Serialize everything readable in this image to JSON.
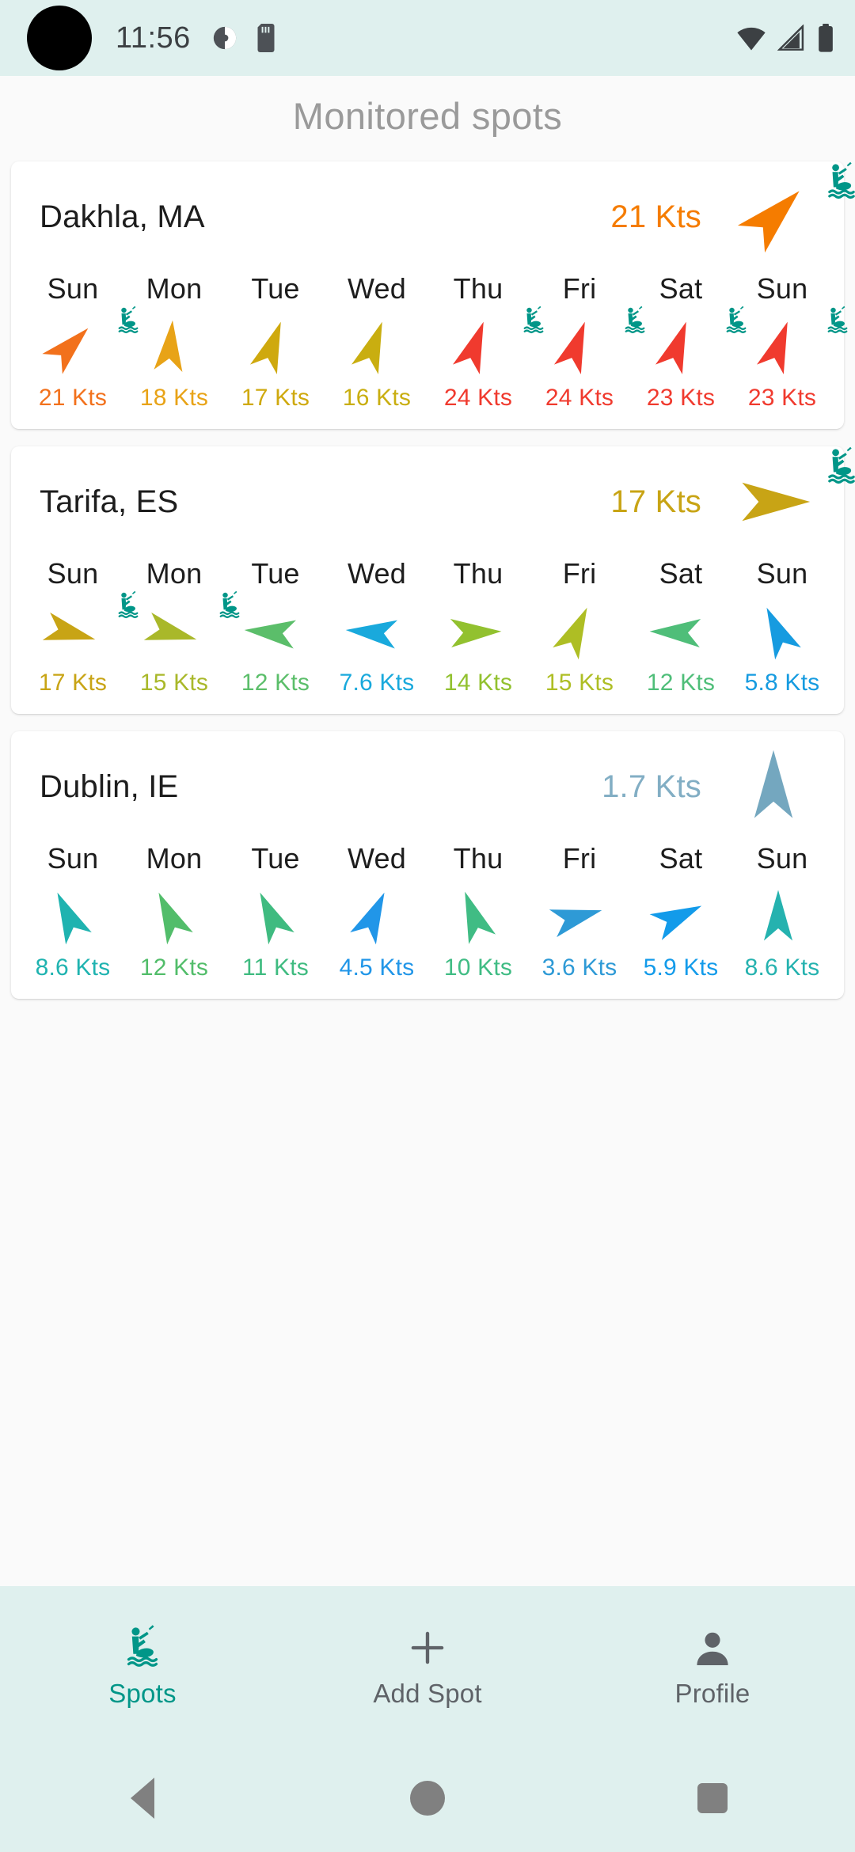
{
  "statusbar": {
    "time": "11:56",
    "icons_left": [
      "do-not-disturb-icon",
      "sd-card-icon"
    ],
    "icons_right": [
      "wifi-icon",
      "cellular-signal-icon",
      "battery-icon"
    ]
  },
  "header": {
    "title": "Monitored spots"
  },
  "theme": {
    "accent": "#009688",
    "statusbar_bg": "#DFF0EE",
    "page_bg": "#FAFAFA",
    "card_bg": "#FFFFFF"
  },
  "cards": [
    {
      "name": "Dakhla, MA",
      "speed": "21 Kts",
      "speed_color": "#F57C00",
      "arrow_color": "#F57C00",
      "arrow_dir": 225,
      "kitable": true,
      "days": [
        {
          "label": "Sun",
          "speed": "21 Kts",
          "color": "#F2711C",
          "dir": 225,
          "kitable": true
        },
        {
          "label": "Mon",
          "speed": "18 Kts",
          "color": "#E8A317",
          "dir": 185,
          "kitable": false
        },
        {
          "label": "Tue",
          "speed": "17 Kts",
          "color": "#CFA90E",
          "dir": 200,
          "kitable": false
        },
        {
          "label": "Wed",
          "speed": "16 Kts",
          "color": "#C9AE10",
          "dir": 200,
          "kitable": false
        },
        {
          "label": "Thu",
          "speed": "24 Kts",
          "color": "#F03A2E",
          "dir": 200,
          "kitable": true
        },
        {
          "label": "Fri",
          "speed": "24 Kts",
          "color": "#F03A2E",
          "dir": 200,
          "kitable": true
        },
        {
          "label": "Sat",
          "speed": "23 Kts",
          "color": "#F03A2E",
          "dir": 200,
          "kitable": true
        },
        {
          "label": "Sun",
          "speed": "23 Kts",
          "color": "#F03A2E",
          "dir": 200,
          "kitable": true
        }
      ]
    },
    {
      "name": "Tarifa, ES",
      "speed": "17 Kts",
      "speed_color": "#C8A415",
      "arrow_color": "#C8A415",
      "arrow_dir": 270,
      "kitable": true,
      "days": [
        {
          "label": "Sun",
          "speed": "17 Kts",
          "color": "#C8A415",
          "dir": 285,
          "kitable": true
        },
        {
          "label": "Mon",
          "speed": "15 Kts",
          "color": "#A9B82A",
          "dir": 285,
          "kitable": true
        },
        {
          "label": "Tue",
          "speed": "12 Kts",
          "color": "#5BBE6A",
          "dir": 95,
          "kitable": false
        },
        {
          "label": "Wed",
          "speed": "7.6 Kts",
          "color": "#19A9DC",
          "dir": 95,
          "kitable": false
        },
        {
          "label": "Thu",
          "speed": "14 Kts",
          "color": "#92C12F",
          "dir": 268,
          "kitable": false
        },
        {
          "label": "Fri",
          "speed": "15 Kts",
          "color": "#AEBE24",
          "dir": 205,
          "kitable": false
        },
        {
          "label": "Sat",
          "speed": "12 Kts",
          "color": "#4FBE79",
          "dir": 92,
          "kitable": false
        },
        {
          "label": "Sun",
          "speed": "5.8 Kts",
          "color": "#169BE0",
          "dir": 155,
          "kitable": false
        }
      ]
    },
    {
      "name": "Dublin, IE",
      "speed": "1.7 Kts",
      "speed_color": "#82AEC4",
      "arrow_color": "#74A7BF",
      "arrow_dir": 180,
      "kitable": false,
      "days": [
        {
          "label": "Sun",
          "speed": "8.6 Kts",
          "color": "#1FB3B0",
          "dir": 155,
          "kitable": false
        },
        {
          "label": "Mon",
          "speed": "12 Kts",
          "color": "#52BD6A",
          "dir": 155,
          "kitable": false
        },
        {
          "label": "Tue",
          "speed": "11 Kts",
          "color": "#3FBB80",
          "dir": 155,
          "kitable": false
        },
        {
          "label": "Wed",
          "speed": "4.5 Kts",
          "color": "#2196E8",
          "dir": 205,
          "kitable": false
        },
        {
          "label": "Thu",
          "speed": "10 Kts",
          "color": "#40BC84",
          "dir": 160,
          "kitable": false
        },
        {
          "label": "Fri",
          "speed": "3.6 Kts",
          "color": "#2E9AD6",
          "dir": 255,
          "kitable": false
        },
        {
          "label": "Sat",
          "speed": "5.9 Kts",
          "color": "#139BEA",
          "dir": 245,
          "kitable": false
        },
        {
          "label": "Sun",
          "speed": "8.6 Kts",
          "color": "#25B2AF",
          "dir": 180,
          "kitable": false
        }
      ]
    }
  ],
  "bottomnav": {
    "items": [
      {
        "label": "Spots",
        "icon": "kitesurfer-icon",
        "active": true
      },
      {
        "label": "Add Spot",
        "icon": "plus-icon",
        "active": false
      },
      {
        "label": "Profile",
        "icon": "person-icon",
        "active": false
      }
    ]
  },
  "sysnav": {
    "buttons": [
      "back-button",
      "home-button",
      "recents-button"
    ]
  }
}
